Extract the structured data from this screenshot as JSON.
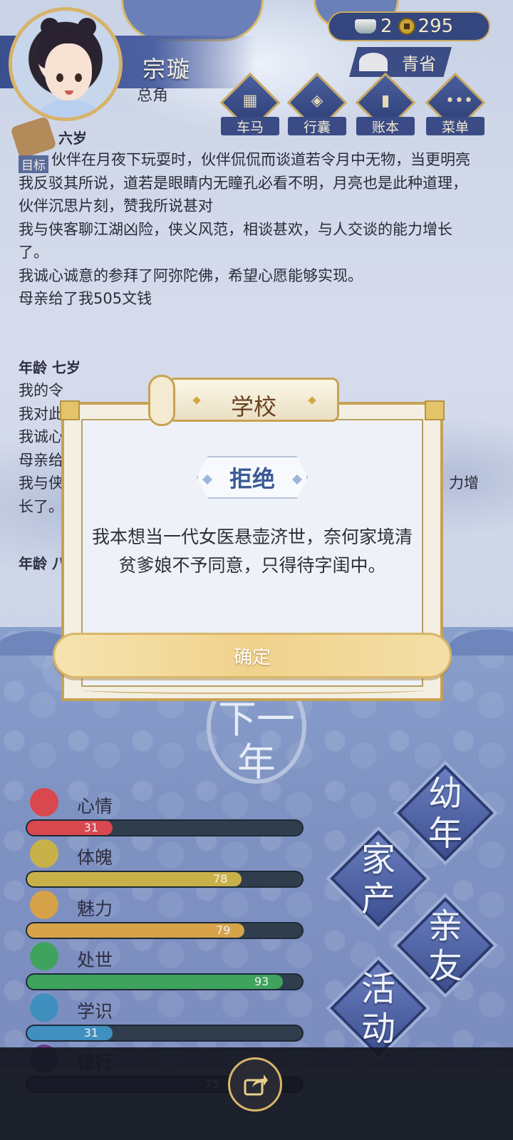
{
  "player": {
    "name": "宗璇",
    "role": "总角"
  },
  "currency": {
    "ingots": "2",
    "coins": "295"
  },
  "location": "青省",
  "menu": [
    {
      "label": "车马",
      "icon": "carriage-icon"
    },
    {
      "label": "行囊",
      "icon": "bag-icon"
    },
    {
      "label": "账本",
      "icon": "ledger-icon"
    },
    {
      "label": "菜单",
      "icon": "menu-dots-icon"
    }
  ],
  "goal_label": "目标",
  "log": {
    "top_partial_age": "六岁",
    "entries_1": [
      "伙伴在月夜下玩耍时，伙伴侃侃而谈道若令月中无物，当更明亮",
      "我反驳其所说，道若是眼睛内无瞳孔必看不明，月亮也是此种道理，伙伴沉思片刻，赞我所说甚对",
      "我与侠客聊江湖凶险，侠义风范，相谈甚欢，与人交谈的能力增长了。",
      "我诚心诚意的参拜了阿弥陀佛，希望心愿能够实现。",
      "母亲给了我505文钱"
    ],
    "age_2": "年龄 七岁",
    "entries_2_visible": [
      "我的令",
      "我对此",
      "我诚心",
      "母亲给",
      "我与侠",
      "长了。"
    ],
    "entries_2_right": [
      "力增"
    ],
    "age_3_partial": "年龄 八"
  },
  "modal": {
    "title": "学校",
    "tag": "拒绝",
    "text": "我本想当一代女医悬壶济世，奈何家境清贫爹娘不予同意，只得待字闺中。",
    "confirm": "确定"
  },
  "next_year": "下一年",
  "stats": [
    {
      "label": "心情",
      "value": 31,
      "color": "#d9474f",
      "icon": "flower-icon"
    },
    {
      "label": "体魄",
      "value": 78,
      "color": "#c9b14a",
      "icon": "stature-icon"
    },
    {
      "label": "魅力",
      "value": 79,
      "color": "#d6a24a",
      "icon": "jade-icon"
    },
    {
      "label": "处世",
      "value": 93,
      "color": "#3fa35e",
      "icon": "scroll-icon"
    },
    {
      "label": "学识",
      "value": 31,
      "color": "#3f8fbf",
      "icon": "books-icon"
    },
    {
      "label": "德行",
      "value": 75,
      "color": "#6a3f8f",
      "icon": "virtue-icon"
    }
  ],
  "stat_max": 100,
  "actions": [
    {
      "label": "幼年"
    },
    {
      "label": "家产"
    },
    {
      "label": "亲友"
    },
    {
      "label": "活动"
    }
  ]
}
